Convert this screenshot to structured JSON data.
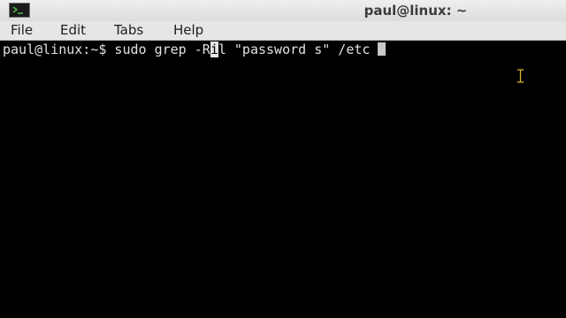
{
  "window": {
    "title": "paul@linux: ~",
    "app_icon": "terminal-icon"
  },
  "menu": {
    "items": [
      "File",
      "Edit",
      "Tabs",
      "Help"
    ]
  },
  "terminal": {
    "prompt": "paul@linux:~$",
    "command_before": " sudo grep -R",
    "command_highlight": "i",
    "command_after": "l \"password s\" /etc ",
    "cursor_icon": "i-beam-cursor-icon"
  },
  "colors": {
    "background": "#000000",
    "text": "#e0e0e0",
    "titlebar": "#e6e6e6"
  }
}
